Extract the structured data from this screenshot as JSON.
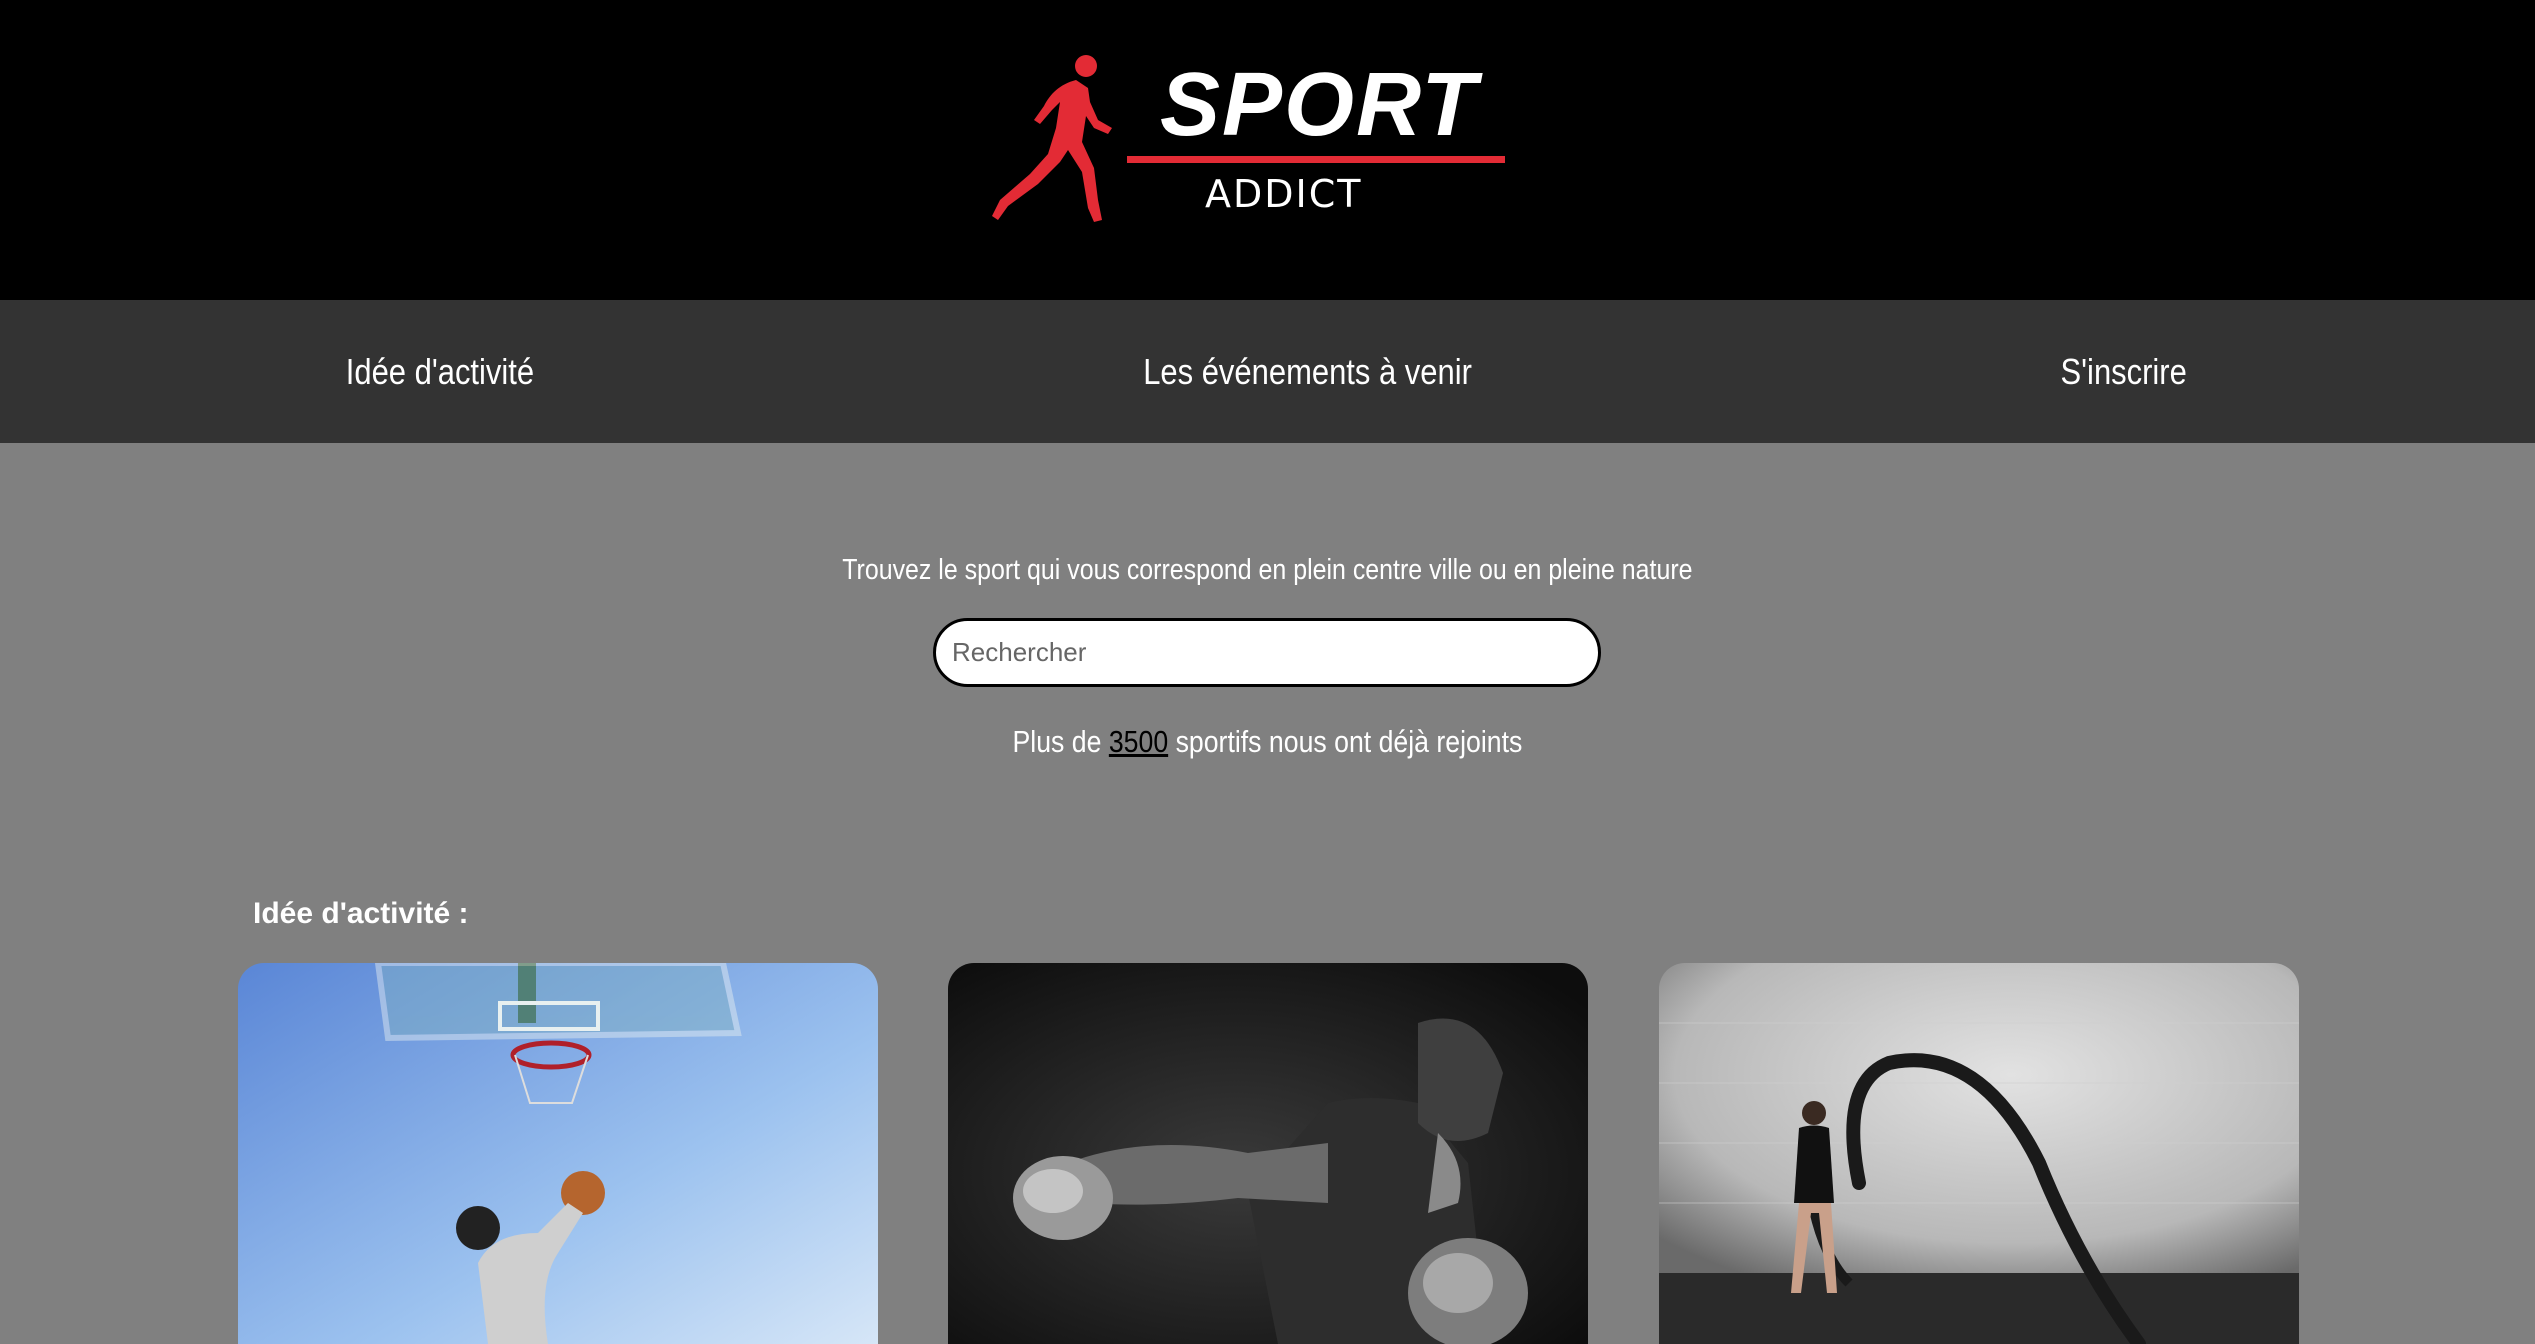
{
  "header": {
    "logo_word": "SPORT",
    "logo_sub": "ADDICT",
    "accent_color": "#e32b35"
  },
  "nav": {
    "items": [
      {
        "label": "Idée d'activité"
      },
      {
        "label": "Les événements à venir"
      },
      {
        "label": "S'inscrire"
      }
    ]
  },
  "hero": {
    "tagline": "Trouvez le sport qui vous correspond en plein centre ville ou en pleine nature",
    "search_placeholder": "Rechercher",
    "count_prefix": "Plus de",
    "count_value": "3500",
    "count_suffix": "sportifs nous ont déjà rejoints"
  },
  "activities": {
    "title": "Idée d'activité :",
    "cards": [
      {
        "image": "basketball-photo"
      },
      {
        "image": "boxing-photo"
      },
      {
        "image": "battle-ropes-photo"
      }
    ]
  }
}
